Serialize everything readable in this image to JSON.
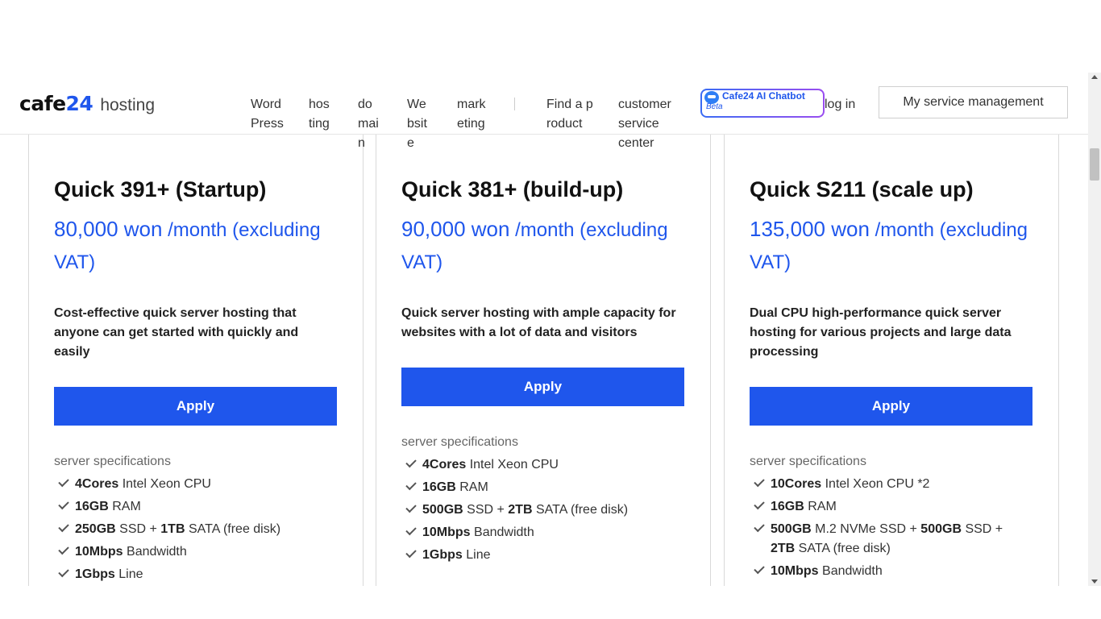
{
  "brand": {
    "logo_cafe": "cafe",
    "logo_24": "24",
    "logo_hosting": "hosting",
    "accent_color": "#1f56ec"
  },
  "nav": {
    "items": [
      "Word Press",
      "hosting",
      "domain",
      "Website",
      "marketing",
      "Find a product",
      "customer service center"
    ],
    "chatbot_title": "Cafe24 AI Chatbot",
    "chatbot_beta": "Beta",
    "login": "log in",
    "my_service": "My service management"
  },
  "plans": [
    {
      "title": "Quick 391+ (Startup)",
      "price_amount": "80,000 won",
      "price_suffix": " /month (excluding VAT)",
      "description": "Cost-effective quick server hosting that anyone can get started with quickly and easily",
      "apply": "Apply",
      "spec_heading": "server specifications",
      "specs": [
        {
          "b1": "4Cores",
          "t1": " Intel Xeon CPU"
        },
        {
          "b1": "16GB",
          "t1": " RAM"
        },
        {
          "b1": "250GB",
          "t1": " SSD + ",
          "b2": "1TB",
          "t2": " SATA (free disk)"
        },
        {
          "b1": "10Mbps",
          "t1": " Bandwidth"
        },
        {
          "b1": "1Gbps",
          "t1": " Line"
        }
      ]
    },
    {
      "title": "Quick 381+ (build-up)",
      "price_amount": "90,000 won",
      "price_suffix": " /month (excluding VAT)",
      "description": "Quick server hosting with ample capacity for websites with a lot of data and visitors",
      "apply": "Apply",
      "spec_heading": "server specifications",
      "specs": [
        {
          "b1": "4Cores",
          "t1": " Intel Xeon CPU"
        },
        {
          "b1": "16GB",
          "t1": " RAM"
        },
        {
          "b1": "500GB",
          "t1": " SSD + ",
          "b2": "2TB",
          "t2": " SATA (free disk)"
        },
        {
          "b1": "10Mbps",
          "t1": " Bandwidth"
        },
        {
          "b1": "1Gbps",
          "t1": " Line"
        }
      ]
    },
    {
      "title": "Quick S211 (scale up)",
      "price_amount": "135,000 won",
      "price_suffix": " /month (excluding VAT)",
      "description": "Dual CPU high-performance quick server hosting for various projects and large data processing",
      "apply": "Apply",
      "spec_heading": "server specifications",
      "specs": [
        {
          "b1": "10Cores",
          "t1": " Intel Xeon CPU *2"
        },
        {
          "b1": "16GB",
          "t1": " RAM"
        },
        {
          "b1": "500GB",
          "t1": " M.2 NVMe SSD + ",
          "b2": "500GB",
          "t2": " SSD + ",
          "b3": "2TB",
          "t3": " SATA (free disk)"
        },
        {
          "b1": "10Mbps",
          "t1": " Bandwidth"
        }
      ]
    }
  ]
}
